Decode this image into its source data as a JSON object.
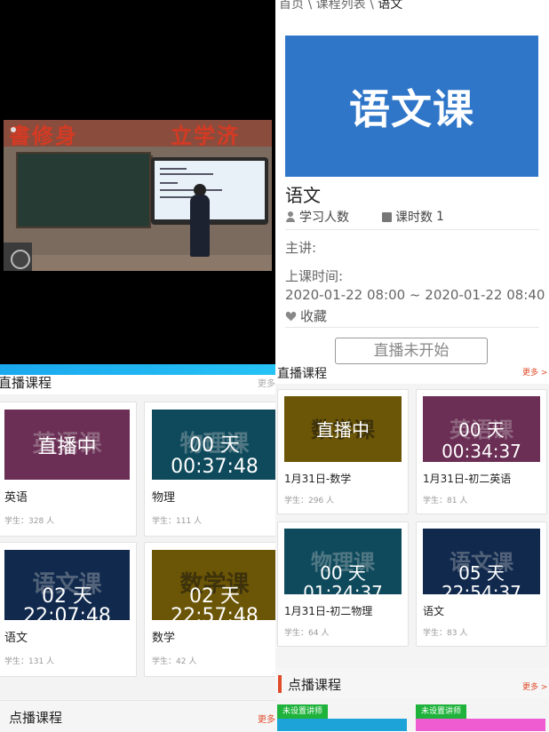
{
  "video": {
    "banner_left": "書修身",
    "banner_right": "立学济"
  },
  "detail": {
    "breadcrumb": {
      "home": "首页",
      "sep": "\\",
      "list": "课程列表",
      "current": "语文"
    },
    "cover_text": "语文课",
    "cover_color": "#2f76c8",
    "title": "语文",
    "learners_label": "学习人数",
    "hours_label": "课时数",
    "hours_value": "1",
    "lecturer_label": "主讲:",
    "time_label": "上课时间:",
    "time_value": "2020-01-22 08:00 ~ 2020-01-22 08:40",
    "favorite_label": "收藏",
    "live_button": "直播未开始"
  },
  "left_list": {
    "header": "直播课程",
    "more": "更多",
    "cards": [
      {
        "ghost": "英语课",
        "overlay1": "直播中",
        "overlay2": "",
        "name": "英语",
        "count": "学生：328 人",
        "color": "#6b2e55"
      },
      {
        "ghost": "物理课",
        "overlay1": "00 天",
        "overlay2": "00:37:48",
        "name": "物理",
        "count": "学生：111 人",
        "color": "#0e4a5c"
      },
      {
        "ghost": "语文课",
        "overlay1": "02 天",
        "overlay2": "22:07:48",
        "name": "语文",
        "count": "学生：131 人",
        "color": "#10294d"
      },
      {
        "ghost": "数学课",
        "overlay1": "02 天",
        "overlay2": "22:57:48",
        "name": "数学",
        "count": "学生：42 人",
        "color": "#6b5506"
      }
    ],
    "vod_header": "点播课程",
    "vod_more": "更多"
  },
  "right_list": {
    "header": "直播课程",
    "more": "更多 >",
    "cards": [
      {
        "ghost": "数学课",
        "overlay1": "直播中",
        "overlay2": "",
        "name": "1月31日-数学",
        "count": "学生：296 人",
        "color": "#6b5506"
      },
      {
        "ghost": "英语课",
        "overlay1": "00 天",
        "overlay2": "00:34:37",
        "name": "1月31日-初二英语",
        "count": "学生：81 人",
        "color": "#6b2e55"
      },
      {
        "ghost": "物理课",
        "overlay1": "00 天",
        "overlay2": "01:24:37",
        "name": "1月31日-初二物理",
        "count": "学生：64 人",
        "color": "#0e4a5c"
      },
      {
        "ghost": "语文课",
        "overlay1": "05 天",
        "overlay2": "22:54:37",
        "name": "语文",
        "count": "学生：83 人",
        "color": "#10294d"
      }
    ],
    "vod_header": "点播课程",
    "vod_more": "更多 >",
    "vod_tags": [
      "未设置讲师",
      "未设置讲师"
    ],
    "vod_colors": [
      "#1ea3d8",
      "#ef5bd0"
    ]
  }
}
